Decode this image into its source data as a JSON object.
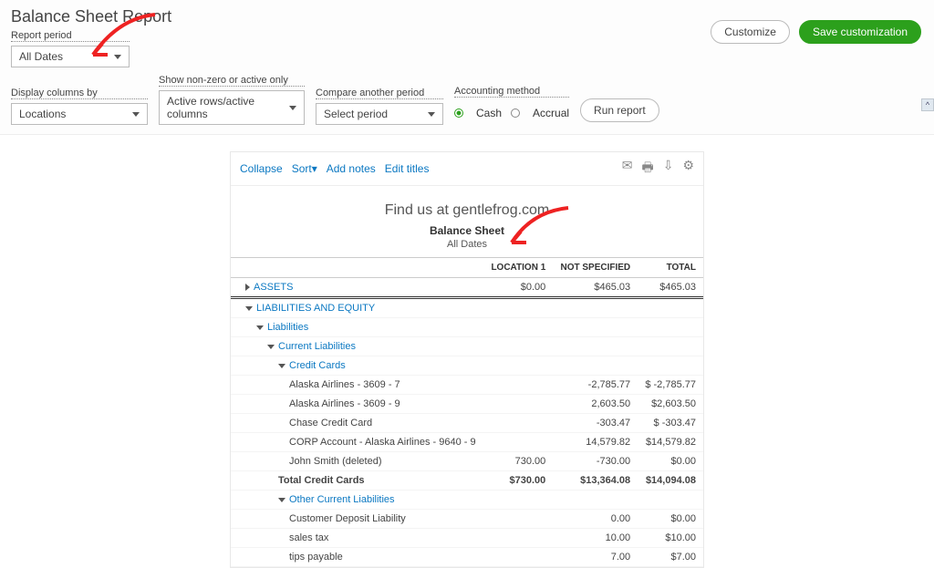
{
  "page": {
    "title": "Balance Sheet Report"
  },
  "buttons": {
    "customize": "Customize",
    "save": "Save customization",
    "run": "Run report"
  },
  "labels": {
    "report_period": "Report period",
    "display_columns": "Display columns by",
    "show_nonzero": "Show non-zero or active only",
    "compare": "Compare another period",
    "method": "Accounting method"
  },
  "selects": {
    "report_period": "All Dates",
    "display_columns": "Locations",
    "show_nonzero": "Active rows/active columns",
    "compare": "Select period"
  },
  "method": {
    "cash": "Cash",
    "accrual": "Accrual",
    "selected": "cash"
  },
  "tools": {
    "collapse": "Collapse",
    "sort": "Sort",
    "addnotes": "Add notes",
    "edittitles": "Edit titles"
  },
  "report": {
    "subtitle": "Find us at gentlefrog.com",
    "title": "Balance Sheet",
    "period": "All Dates",
    "cols": {
      "c1": "LOCATION 1",
      "c2": "NOT SPECIFIED",
      "c3": "TOTAL"
    },
    "rows": {
      "assets": {
        "l": "ASSETS",
        "c1": "$0.00",
        "c2": "$465.03",
        "c3": "$465.03"
      },
      "le": {
        "l": "LIABILITIES AND EQUITY"
      },
      "liab": {
        "l": "Liabilities"
      },
      "cliab": {
        "l": "Current Liabilities"
      },
      "cc": {
        "l": "Credit Cards"
      },
      "aa7": {
        "l": "Alaska Airlines - 3609 - 7",
        "c1": "",
        "c2": "-2,785.77",
        "c3": "$ -2,785.77"
      },
      "aa9": {
        "l": "Alaska Airlines - 3609 - 9",
        "c1": "",
        "c2": "2,603.50",
        "c3": "$2,603.50"
      },
      "chase": {
        "l": "Chase Credit Card",
        "c1": "",
        "c2": "-303.47",
        "c3": "$ -303.47"
      },
      "corp": {
        "l": "CORP Account - Alaska Airlines - 9640 - 9",
        "c1": "",
        "c2": "14,579.82",
        "c3": "$14,579.82"
      },
      "john": {
        "l": "John Smith (deleted)",
        "c1": "730.00",
        "c2": "-730.00",
        "c3": "$0.00"
      },
      "tcc": {
        "l": "Total Credit Cards",
        "c1": "$730.00",
        "c2": "$13,364.08",
        "c3": "$14,094.08"
      },
      "ocl": {
        "l": "Other Current Liabilities"
      },
      "cdl": {
        "l": "Customer Deposit Liability",
        "c1": "",
        "c2": "0.00",
        "c3": "$0.00"
      },
      "stax": {
        "l": "sales tax",
        "c1": "",
        "c2": "10.00",
        "c3": "$10.00"
      },
      "tips": {
        "l": "tips payable",
        "c1": "",
        "c2": "7.00",
        "c3": "$7.00"
      }
    }
  }
}
